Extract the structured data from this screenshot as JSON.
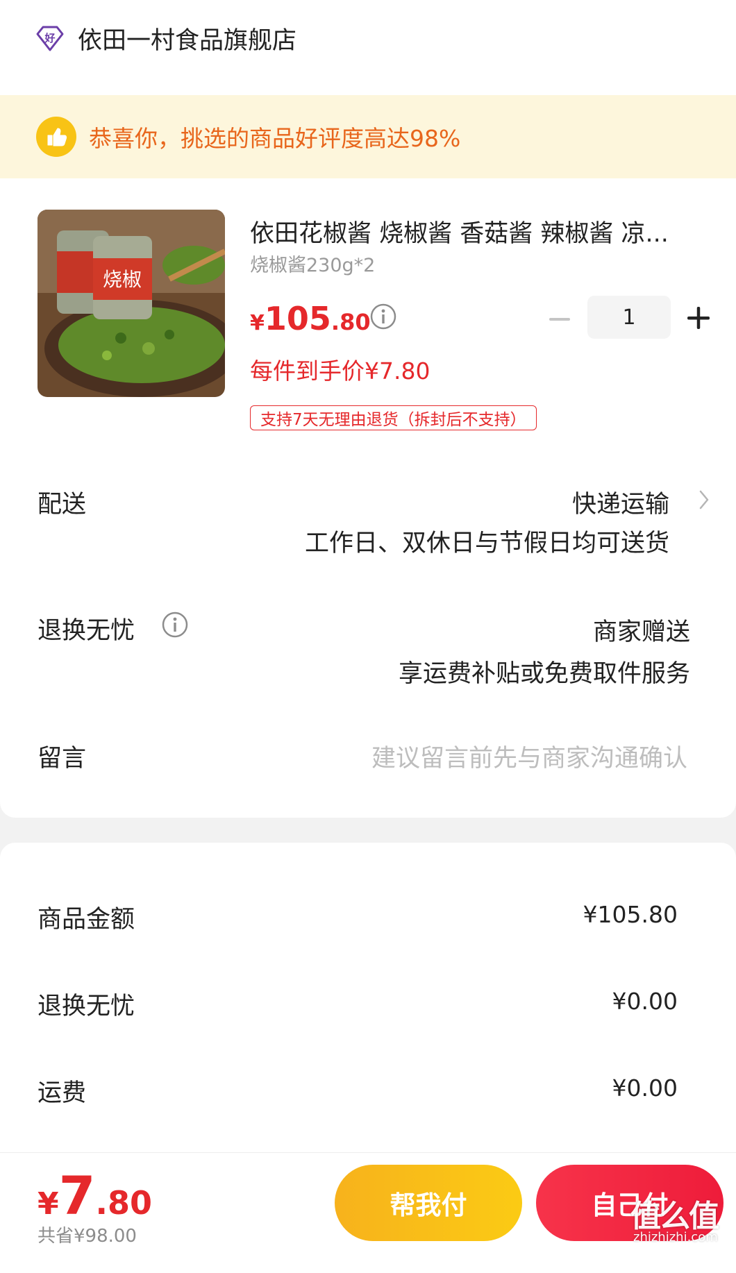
{
  "store": {
    "name": "依田一村食品旗舰店",
    "icon": "haohuo-badge-icon"
  },
  "banner": {
    "text": "恭喜你，挑选的商品好评度高达98%",
    "icon": "thumbs-up-icon"
  },
  "product": {
    "title": "依田花椒酱 烧椒酱 香菇酱 辣椒酱 凉...",
    "spec": "烧椒酱230g*2",
    "price_yen": "¥",
    "price_int": "105",
    "price_dec": ".80",
    "per_item_price": "每件到手价¥7.80",
    "return_tag": "支持7天无理由退货（拆封后不支持）",
    "quantity": "1"
  },
  "delivery": {
    "label": "配送",
    "method": "快递运输",
    "note": "工作日、双休日与节假日均可送货"
  },
  "return_service": {
    "label": "退换无忧",
    "value": "商家赠送",
    "note": "享运费补贴或免费取件服务"
  },
  "message": {
    "label": "留言",
    "placeholder": "建议留言前先与商家沟通确认"
  },
  "summary": {
    "items": [
      {
        "label": "商品金额",
        "value": "¥105.80"
      },
      {
        "label": "退换无忧",
        "value": "¥0.00"
      },
      {
        "label": "运费",
        "value": "¥0.00"
      }
    ]
  },
  "footer": {
    "final_yen": "¥",
    "final_int": "7",
    "final_dec": ".80",
    "saved": "共省¥98.00",
    "help_pay_label": "帮我付",
    "self_pay_label": "自己付"
  },
  "watermark": {
    "main": "值么值",
    "sub": "zhizhizhi.com"
  },
  "colors": {
    "accent_red": "#e5282b",
    "banner_bg": "#fdf6dc",
    "banner_text": "#e8661c",
    "help_btn": "#f9bd17",
    "self_btn": "#f22b44"
  }
}
